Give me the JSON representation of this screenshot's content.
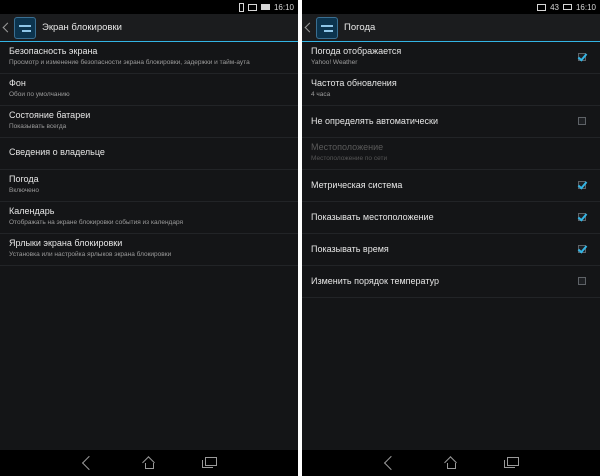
{
  "left": {
    "status": {
      "time": "16:10"
    },
    "title": "Экран блокировки",
    "items": [
      {
        "title": "Безопасность экрана",
        "summary": "Просмотр и изменение безопасности экрана блокировки, задержки и тайм-аута"
      },
      {
        "title": "Фон",
        "summary": "Обои по умолчанию"
      },
      {
        "title": "Состояние батареи",
        "summary": "Показывать всегда"
      },
      {
        "title": "Сведения о владельце",
        "summary": ""
      },
      {
        "title": "Погода",
        "summary": "Включено"
      },
      {
        "title": "Календарь",
        "summary": "Отображать на экране блокировки события из календаря"
      },
      {
        "title": "Ярлыки экрана блокировки",
        "summary": "Установка или настройка ярлыков экрана блокировки"
      }
    ]
  },
  "right": {
    "status": {
      "battery": "43",
      "time": "16:10"
    },
    "title": "Погода",
    "items": [
      {
        "title": "Погода отображается",
        "summary": "Yahoo! Weather",
        "checked": true
      },
      {
        "title": "Частота обновления",
        "summary": "4 часа"
      },
      {
        "title": "Не определять автоматически",
        "summary": "",
        "checked": false
      },
      {
        "title": "Местоположение",
        "summary": "Местоположение по сети",
        "disabled": true
      },
      {
        "title": "Метрическая система",
        "summary": "",
        "checked": true
      },
      {
        "title": "Показывать местоположение",
        "summary": "",
        "checked": true
      },
      {
        "title": "Показывать время",
        "summary": "",
        "checked": true
      },
      {
        "title": "Изменить порядок температур",
        "summary": "",
        "checked": false
      }
    ]
  },
  "accent_color": "#33b5e5",
  "icons": {
    "status": [
      "signal-icon",
      "mail-icon",
      "battery-icon"
    ],
    "nav": [
      "back-nav-icon",
      "home-nav-icon",
      "recent-apps-icon"
    ]
  }
}
